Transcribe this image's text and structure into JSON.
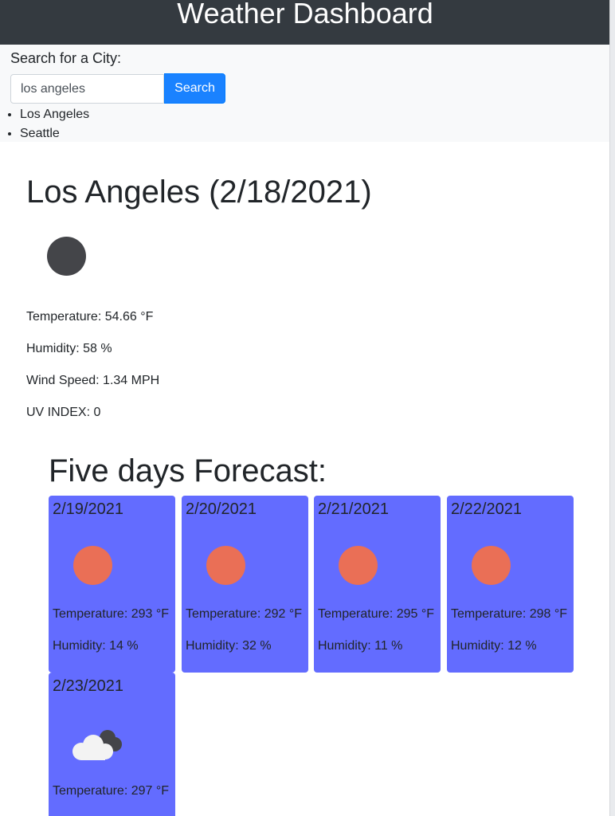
{
  "header": {
    "title": "Weather Dashboard"
  },
  "search": {
    "label": "Search for a City:",
    "value": "los angeles",
    "button_label": "Search"
  },
  "history": [
    "Los Angeles",
    "Seattle"
  ],
  "current": {
    "title": "Los Angeles (2/18/2021)",
    "icon": "moon-icon",
    "temperature": "Temperature: 54.66 °F",
    "humidity": "Humidity: 58 %",
    "wind": "Wind Speed: 1.34 MPH",
    "uv": "UV INDEX: 0"
  },
  "forecast": {
    "title": "Five days Forecast:",
    "days": [
      {
        "date": "2/19/2021",
        "icon": "sun-icon",
        "temperature": "Temperature: 293 °F",
        "humidity": "Humidity: 14 %"
      },
      {
        "date": "2/20/2021",
        "icon": "sun-icon",
        "temperature": "Temperature: 292 °F",
        "humidity": "Humidity: 32 %"
      },
      {
        "date": "2/21/2021",
        "icon": "sun-icon",
        "temperature": "Temperature: 295 °F",
        "humidity": "Humidity: 11 %"
      },
      {
        "date": "2/22/2021",
        "icon": "sun-icon",
        "temperature": "Temperature: 298 °F",
        "humidity": "Humidity: 12 %"
      },
      {
        "date": "2/23/2021",
        "icon": "cloud-icon",
        "temperature": "Temperature: 297 °F",
        "humidity": ""
      }
    ]
  },
  "colors": {
    "header_bg": "#343a40",
    "button_bg": "#1a82ff",
    "card_bg": "#636cff",
    "sun": "#ea6f56",
    "moon": "#444549"
  }
}
